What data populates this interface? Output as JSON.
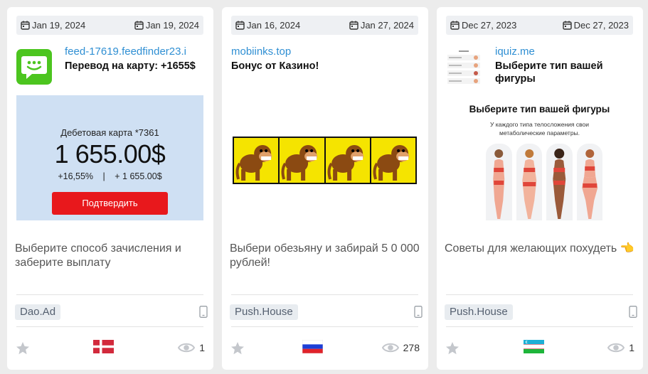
{
  "colors": {
    "link": "#2f8fd3",
    "green_icon": "#4cc51f",
    "confirm_button": "#e8181c",
    "monkey_bg": "#f5e400"
  },
  "cards": [
    {
      "start_date": "Jan 19, 2024",
      "end_date": "Jan 19, 2024",
      "domain": "feed-17619.feedfinder23.i",
      "title": "Перевод на карту: +1655$",
      "creative": {
        "card_label": "Дебетовая карта *7361",
        "amount": "1 655.00$",
        "percent": "+16,55%",
        "separator": "|",
        "plus_amount": "+ 1 655.00$",
        "button": "Подтвердить"
      },
      "description": "Выберите способ зачисления и заберите выплату",
      "network": "Dao.Ad",
      "device_icon": "mobile-icon",
      "flag": "denmark-flag",
      "views": "1"
    },
    {
      "start_date": "Jan 16, 2024",
      "end_date": "Jan 27, 2024",
      "domain": "mobiinks.top",
      "title": "Бонус от Казино!",
      "creative": {
        "tiles": 4
      },
      "description": "Выбери обезьяну и забирай 5 0 000 рублей!",
      "network": "Push.House",
      "device_icon": "mobile-icon",
      "flag": "russia-flag",
      "views": "278"
    },
    {
      "start_date": "Dec 27, 2023",
      "end_date": "Dec 27, 2023",
      "domain": "iquiz.me",
      "title": "Выберите тип вашей фигуры",
      "creative": {
        "heading": "Выберите тип вашей фигуры",
        "subheading": "У каждого типа телосложения свои метаболические параметры."
      },
      "description": "Советы для желающих похудеть 👈",
      "network": "Push.House",
      "device_icon": "mobile-icon",
      "flag": "uzbekistan-flag",
      "views": "1"
    }
  ]
}
